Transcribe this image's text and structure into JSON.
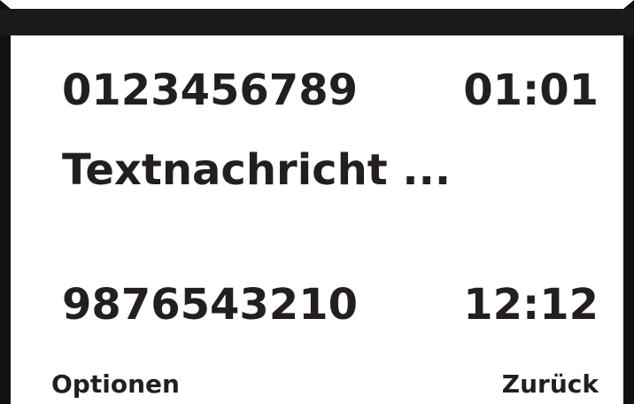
{
  "messages": [
    {
      "number": "0123456789",
      "time": "01:01",
      "preview": "Textnachricht ..."
    },
    {
      "number": "9876543210",
      "time": "12:12"
    }
  ],
  "softkeys": {
    "left_label": "Optionen",
    "right_label": "Zurück"
  },
  "colors": {
    "text": "#231f20",
    "status_bar": "#1a1a1a",
    "frame": "#111111",
    "background": "#ffffff"
  }
}
